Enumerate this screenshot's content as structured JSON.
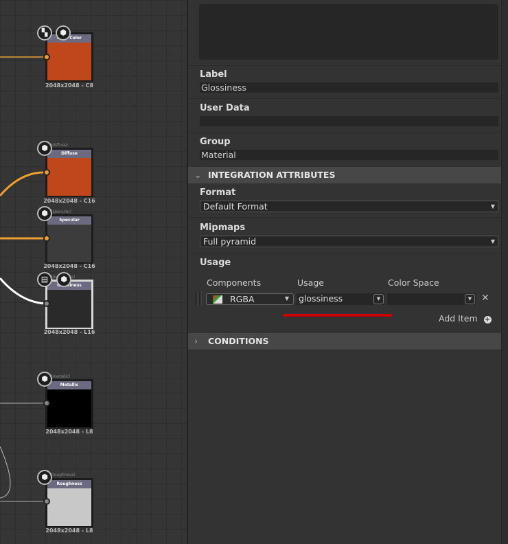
{
  "nodes": [
    {
      "title": "Base Color",
      "tag": "(baseColor)",
      "res": "2048x2048 - C8"
    },
    {
      "title": "Diffuse",
      "tag": "(diffuse)",
      "res": "2048x2048 - C16"
    },
    {
      "title": "Specular",
      "tag": "(specular)",
      "res": "2048x2048 - C16"
    },
    {
      "title": "Glossiness",
      "tag": "(glossiness)",
      "res": "2048x2048 - L16"
    },
    {
      "title": "Metallic",
      "tag": "(metallic)",
      "res": "2048x2048 - L8"
    },
    {
      "title": "Roughness",
      "tag": "(roughness)",
      "res": "2048x2048 - L8"
    }
  ],
  "panel": {
    "label": {
      "title": "Label",
      "value": "Glossiness"
    },
    "user_data": {
      "title": "User Data",
      "value": ""
    },
    "group": {
      "title": "Group",
      "value": "Material"
    },
    "integration": {
      "title": "INTEGRATION ATTRIBUTES",
      "format": {
        "title": "Format",
        "value": "Default Format"
      },
      "mipmaps": {
        "title": "Mipmaps",
        "value": "Full pyramid"
      },
      "usage": {
        "title": "Usage",
        "col_components": "Components",
        "col_usage": "Usage",
        "col_colorspace": "Color Space",
        "row": {
          "components": "RGBA",
          "usage": "glossiness",
          "colorspace": ""
        },
        "add_item": "Add Item"
      }
    },
    "conditions": {
      "title": "CONDITIONS"
    }
  },
  "colors": {
    "orange": "#f0a030",
    "highlight": "#cc0000"
  }
}
